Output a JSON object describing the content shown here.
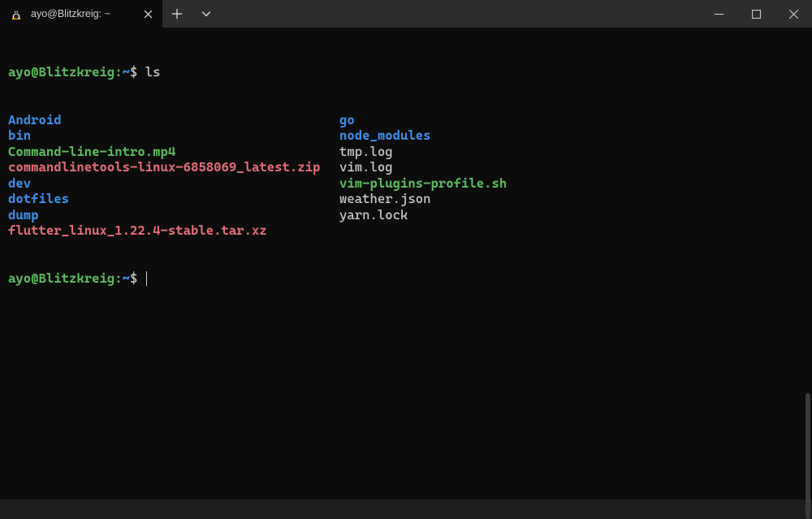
{
  "tab": {
    "title": "ayo@Blitzkreig: ~"
  },
  "prompt": {
    "user_host": "ayo@Blitzkreig",
    "colon": ":",
    "path": "~",
    "dollar": "$"
  },
  "command": "ls",
  "ls": {
    "col1": [
      {
        "text": "Android",
        "cls": "c-dir"
      },
      {
        "text": "bin",
        "cls": "c-dir"
      },
      {
        "text": "Command-line-intro.mp4",
        "cls": "c-exec"
      },
      {
        "text": "commandlinetools-linux-6858069_latest.zip",
        "cls": "c-archive"
      },
      {
        "text": "dev",
        "cls": "c-dir"
      },
      {
        "text": "dotfiles",
        "cls": "c-dir"
      },
      {
        "text": "dump",
        "cls": "c-dir"
      },
      {
        "text": "flutter_linux_1.22.4-stable.tar.xz",
        "cls": "c-archive"
      }
    ],
    "col2": [
      {
        "text": "go",
        "cls": "c-dir"
      },
      {
        "text": "node_modules",
        "cls": "c-dir"
      },
      {
        "text": "tmp.log",
        "cls": "c-file"
      },
      {
        "text": "vim.log",
        "cls": "c-file"
      },
      {
        "text": "vim-plugins-profile.sh",
        "cls": "c-exec"
      },
      {
        "text": "weather.json",
        "cls": "c-file"
      },
      {
        "text": "yarn.lock",
        "cls": "c-file"
      }
    ]
  }
}
